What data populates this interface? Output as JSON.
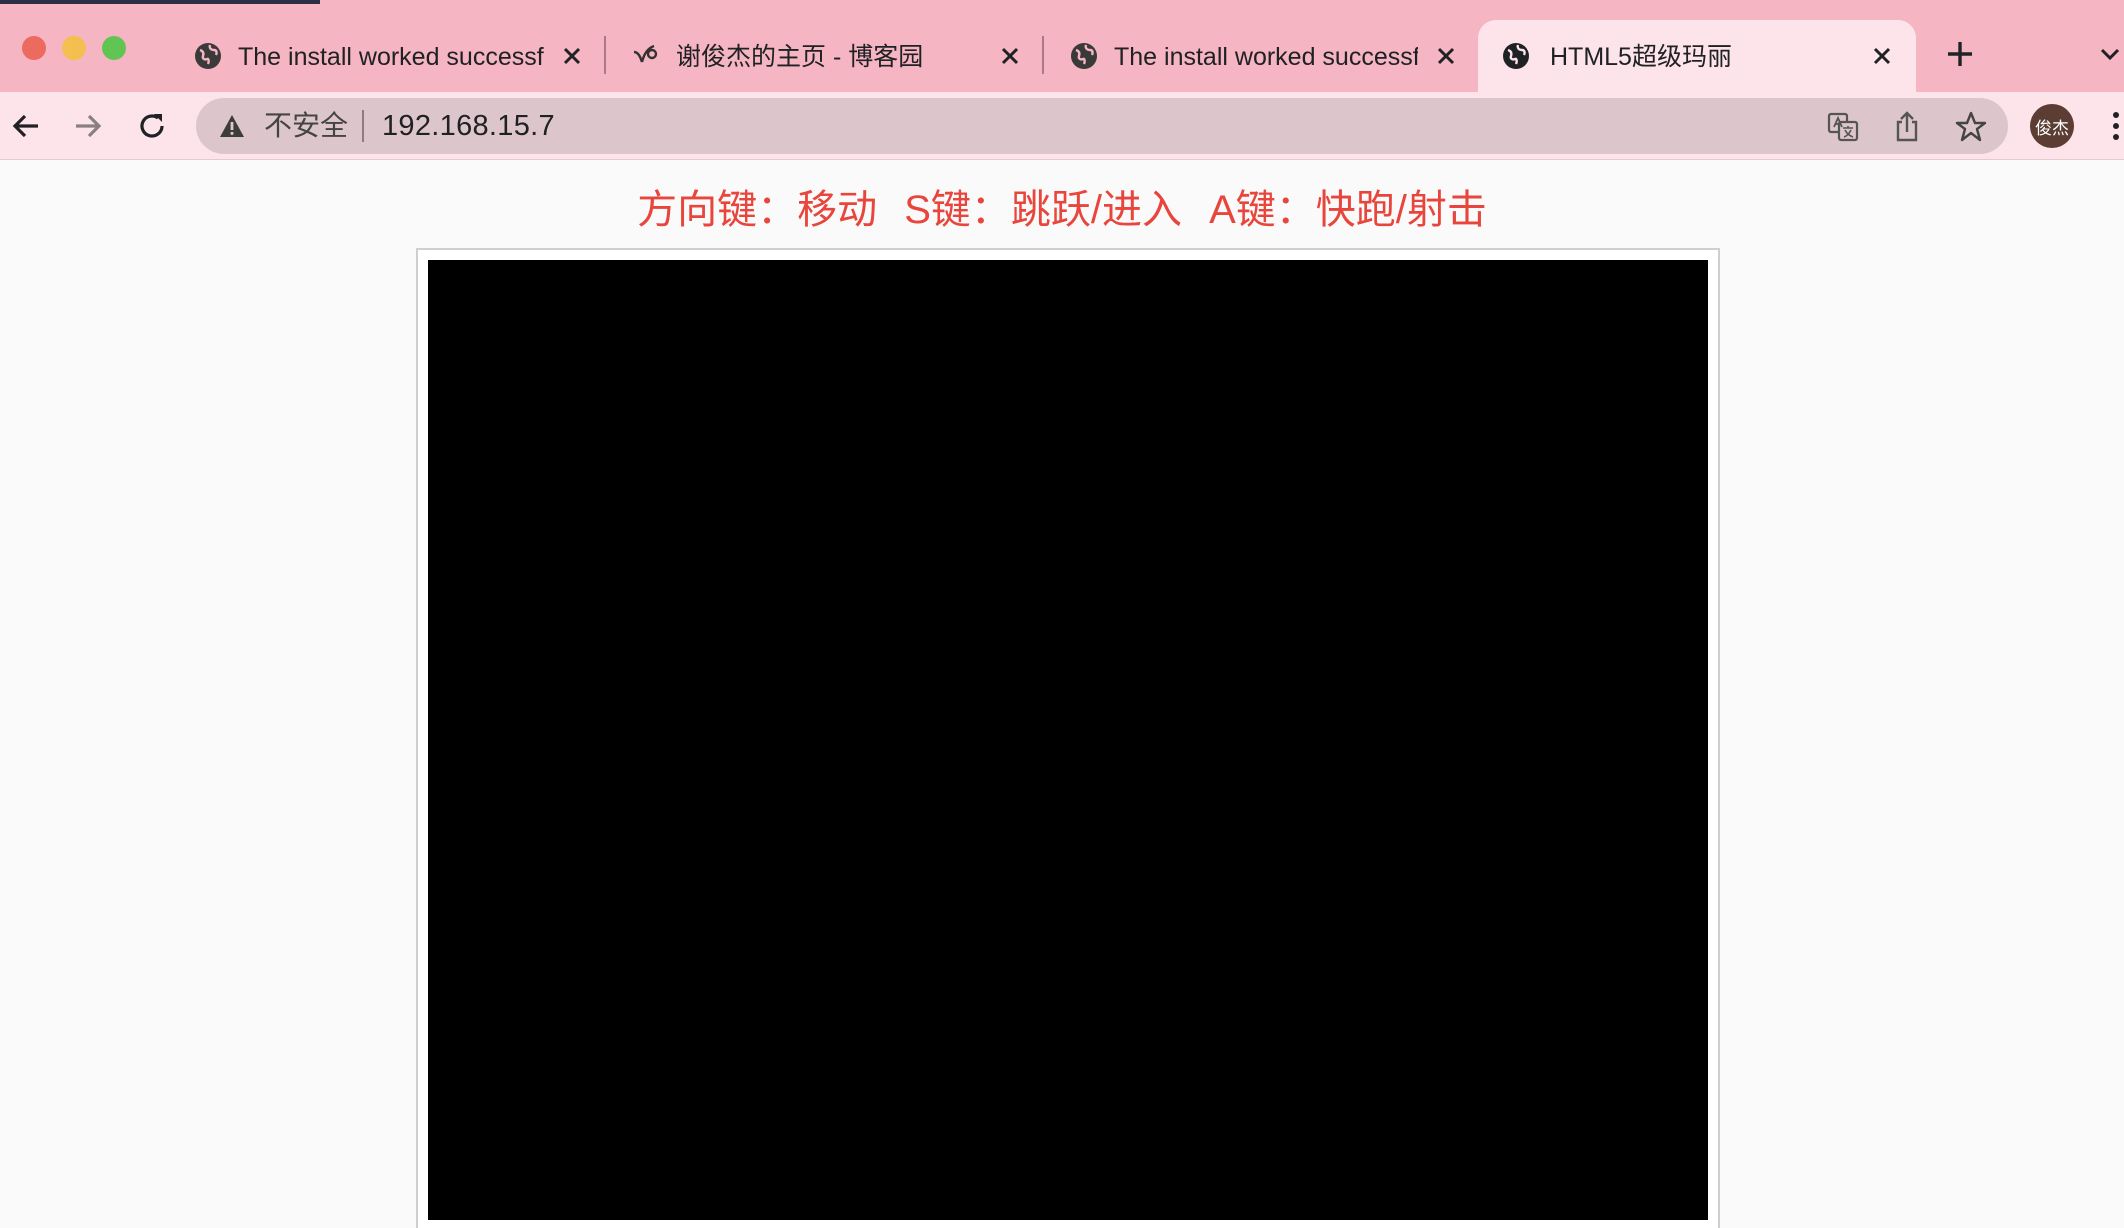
{
  "browser": {
    "tabs": [
      {
        "title": "The install worked successfully! Congratulations!",
        "favicon": "globe-icon",
        "active": false
      },
      {
        "title": "谢俊杰的主页 - 博客园",
        "favicon": "cnblogs-icon",
        "active": false
      },
      {
        "title": "The install worked successfully! Congratulations!",
        "favicon": "globe-icon",
        "active": false
      },
      {
        "title": "HTML5超级玛丽",
        "favicon": "globe-icon",
        "active": true
      }
    ],
    "address_bar": {
      "security_label": "不安全",
      "url": "192.168.15.7"
    },
    "profile_avatar": "俊杰",
    "colors": {
      "tabstrip": "#f5b5c3",
      "toolbar": "#fde4ea",
      "omnibox": "#ddc6cb"
    }
  },
  "page": {
    "instructions": {
      "move": "方向键：移动",
      "jump": "S键：跳跃/进入",
      "run": "A键：快跑/射击"
    },
    "instruction_color": "#e8463c"
  }
}
